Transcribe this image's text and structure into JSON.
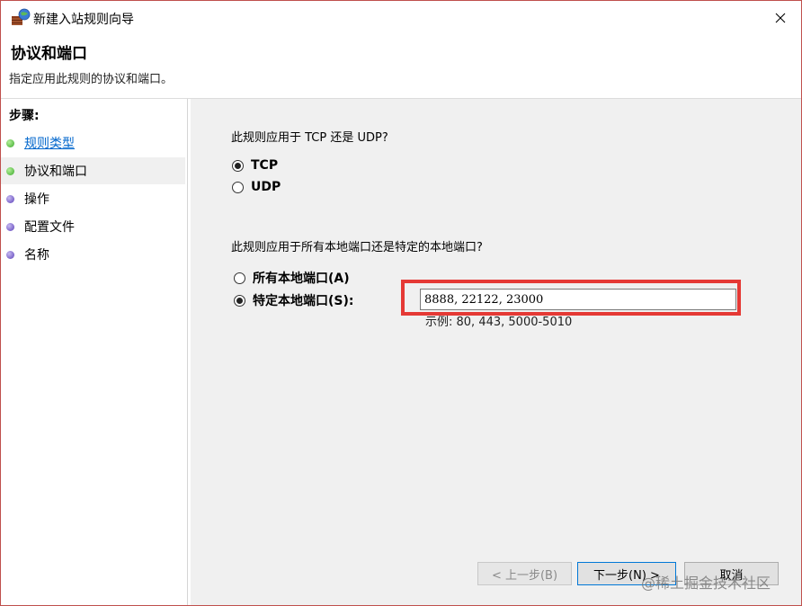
{
  "window": {
    "title": "新建入站规则向导",
    "close_icon": "close-icon",
    "app_icon": "firewall-wizard-icon"
  },
  "header": {
    "title": "协议和端口",
    "subtitle": "指定应用此规则的协议和端口。"
  },
  "steps": {
    "heading": "步骤:",
    "items": [
      {
        "label": "规则类型",
        "status": "done",
        "color": "#3aa82a"
      },
      {
        "label": "协议和端口",
        "status": "current",
        "color": "#3aa82a"
      },
      {
        "label": "操作",
        "status": "pending",
        "color": "#5b3fb8"
      },
      {
        "label": "配置文件",
        "status": "pending",
        "color": "#5b3fb8"
      },
      {
        "label": "名称",
        "status": "pending",
        "color": "#5b3fb8"
      }
    ]
  },
  "protocol": {
    "question": "此规则应用于 TCP 还是 UDP?",
    "options": [
      {
        "label": "TCP",
        "checked": true
      },
      {
        "label": "UDP",
        "checked": false
      }
    ]
  },
  "ports": {
    "question": "此规则应用于所有本地端口还是特定的本地端口?",
    "options": [
      {
        "label": "所有本地端口(A)",
        "checked": false
      },
      {
        "label": "特定本地端口(S):",
        "checked": true
      }
    ],
    "value": "8888, 22122, 23000",
    "example": "示例: 80, 443, 5000-5010"
  },
  "buttons": {
    "back": "< 上一步(B)",
    "next": "下一步(N) >",
    "cancel": "取消"
  },
  "watermark": "@稀土掘金技术社区",
  "colors": {
    "highlight": "#e53935",
    "link": "#0066cc",
    "content_bg": "#f0f0f0"
  }
}
